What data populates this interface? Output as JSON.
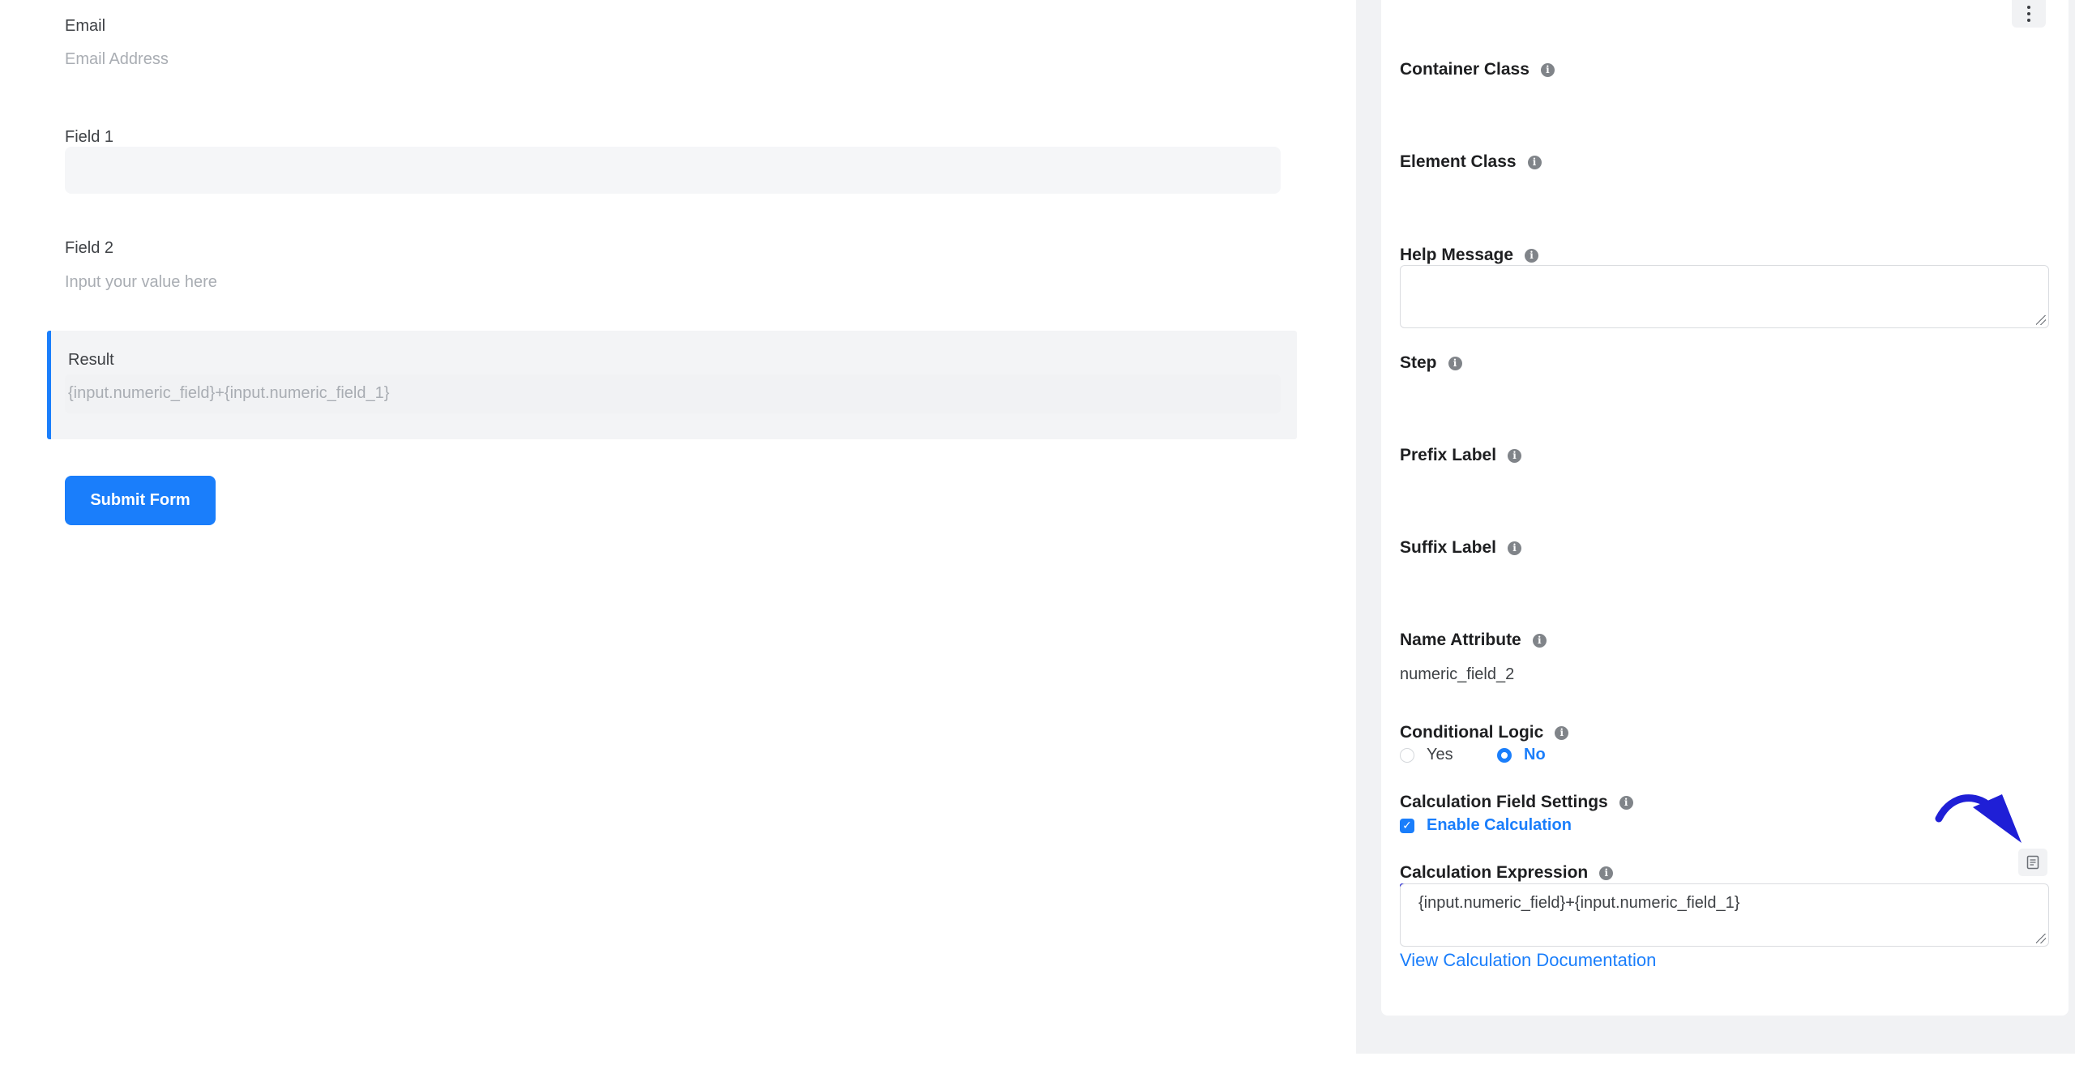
{
  "preview": {
    "email": {
      "label": "Email",
      "placeholder": "Email Address"
    },
    "field1": {
      "label": "Field 1",
      "value": ""
    },
    "field2": {
      "label": "Field 2",
      "placeholder": "Input your value here"
    },
    "result": {
      "label": "Result",
      "placeholder": "{input.numeric_field}+{input.numeric_field_1}"
    },
    "submit_label": "Submit Form"
  },
  "settings": {
    "container_class": {
      "label": "Container Class"
    },
    "element_class": {
      "label": "Element Class"
    },
    "help_message": {
      "label": "Help Message",
      "value": ""
    },
    "step": {
      "label": "Step"
    },
    "prefix_label": {
      "label": "Prefix Label"
    },
    "suffix_label": {
      "label": "Suffix Label"
    },
    "name_attribute": {
      "label": "Name Attribute",
      "value": "numeric_field_2"
    },
    "conditional_logic": {
      "label": "Conditional Logic",
      "options": [
        "Yes",
        "No"
      ],
      "selected": "No"
    },
    "calculation_settings": {
      "label": "Calculation Field Settings",
      "enable_label": "Enable Calculation",
      "enabled": true
    },
    "calculation_expression": {
      "label": "Calculation Expression",
      "value": "{input.numeric_field}+{input.numeric_field_1}"
    },
    "doc_link": "View Calculation Documentation"
  },
  "colors": {
    "accent": "#1a7efb",
    "annotation": "#1f1fd6"
  },
  "icons": {
    "info": "info-icon",
    "more": "vertical-dots-icon",
    "editor": "document-icon",
    "annotation": "curved-arrow-icon"
  }
}
